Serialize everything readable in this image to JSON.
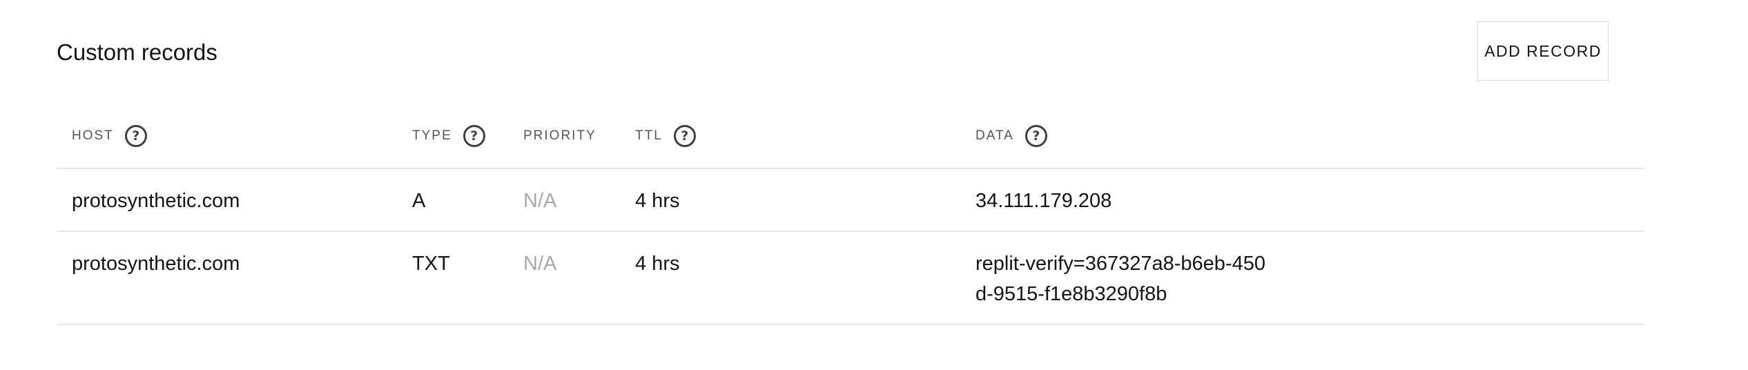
{
  "section": {
    "title": "Custom records",
    "add_record_label": "ADD RECORD"
  },
  "table": {
    "columns": {
      "host": "HOST",
      "type": "TYPE",
      "priority": "PRIORITY",
      "ttl": "TTL",
      "data": "DATA"
    },
    "help_glyph": "?",
    "rows": [
      {
        "host": "protosynthetic.com",
        "type": "A",
        "priority": "N/A",
        "ttl": "4 hrs",
        "data": "34.111.179.208"
      },
      {
        "host": "protosynthetic.com",
        "type": "TXT",
        "priority": "N/A",
        "ttl": "4 hrs",
        "data": "replit-verify=367327a8-b6eb-450d-9515-f1e8b3290f8b"
      }
    ]
  },
  "icons": {
    "help": "question-circle-icon"
  },
  "colors": {
    "text": "#141414",
    "muted": "#a8a8a8",
    "header_text": "#555555",
    "divider": "#e6e6e6",
    "button_border": "#d9d9d9"
  }
}
